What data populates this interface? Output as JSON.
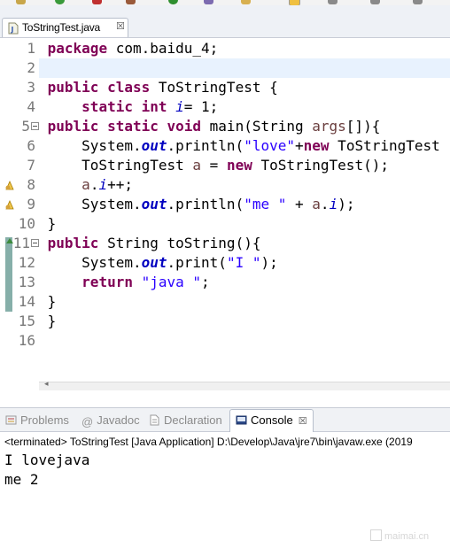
{
  "editor_tab": {
    "title": "ToStringTest.java",
    "close": "☒"
  },
  "code": {
    "line_numbers": [
      "1",
      "2",
      "3",
      "4",
      "5",
      "6",
      "7",
      "8",
      "9",
      "10",
      "11",
      "12",
      "13",
      "14",
      "15",
      "16"
    ]
  },
  "views": {
    "problems": "Problems",
    "javadoc": "Javadoc",
    "declaration": "Declaration",
    "console": "Console",
    "close": "☒"
  },
  "console": {
    "terminated": "<terminated> ToStringTest [Java Application] D:\\Develop\\Java\\jre7\\bin\\javaw.exe (2019",
    "output": [
      "I lovejava",
      "me 2"
    ]
  },
  "watermark": "maimai.cn",
  "colors": {
    "keyword": "#7f0055",
    "string": "#2a00ff",
    "field": "#0000c0",
    "current_line": "#e8f2fe"
  },
  "icons": [
    "java-file-icon",
    "warning-icon",
    "override-icon",
    "problems-icon",
    "javadoc-icon",
    "declaration-icon",
    "console-icon"
  ]
}
